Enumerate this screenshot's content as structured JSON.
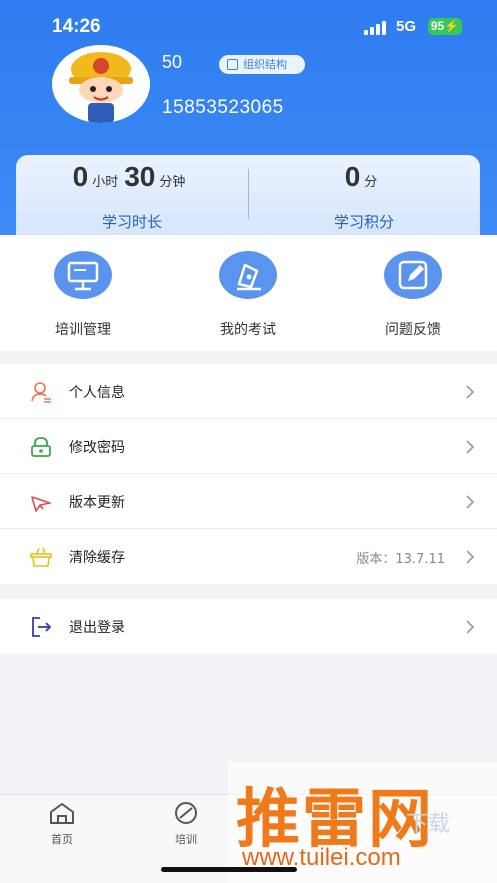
{
  "status_bar": {
    "time": "14:26",
    "network": "5G",
    "battery": "95"
  },
  "profile": {
    "name": "50",
    "org_label": "组织结构",
    "phone": "15853523065"
  },
  "stats": {
    "study_hours": "0",
    "hours_unit": "小时",
    "study_minutes": "30",
    "minutes_unit": "分钟",
    "study_time_label": "学习时长",
    "points": "0",
    "points_unit": "分",
    "points_label": "学习积分"
  },
  "quick_actions": [
    {
      "label": "培训管理",
      "icon": "training-board-icon"
    },
    {
      "label": "我的考试",
      "icon": "exam-pen-icon"
    },
    {
      "label": "问题反馈",
      "icon": "feedback-edit-icon"
    }
  ],
  "menu": {
    "items": [
      {
        "label": "个人信息",
        "icon": "person-icon",
        "color": "#e8734a"
      },
      {
        "label": "修改密码",
        "icon": "lock-icon",
        "color": "#38a84a"
      },
      {
        "label": "版本更新",
        "icon": "rocket-icon",
        "color": "#e24a4a"
      },
      {
        "label": "清除缓存",
        "icon": "basket-icon",
        "color": "#e6c21a",
        "extra": "版本：13.7.11"
      }
    ],
    "logout": {
      "label": "退出登录",
      "icon": "logout-icon",
      "color": "#3b3bb0"
    }
  },
  "tabs": [
    {
      "label": "首页",
      "icon": "home-icon"
    },
    {
      "label": "培训",
      "icon": "compass-icon"
    }
  ],
  "watermark": {
    "main": "推雷网",
    "url": "www.tuilei.com",
    "sub": "下载"
  },
  "colors": {
    "primary": "#2f7cf0",
    "accent_label": "#2a5fb8"
  }
}
